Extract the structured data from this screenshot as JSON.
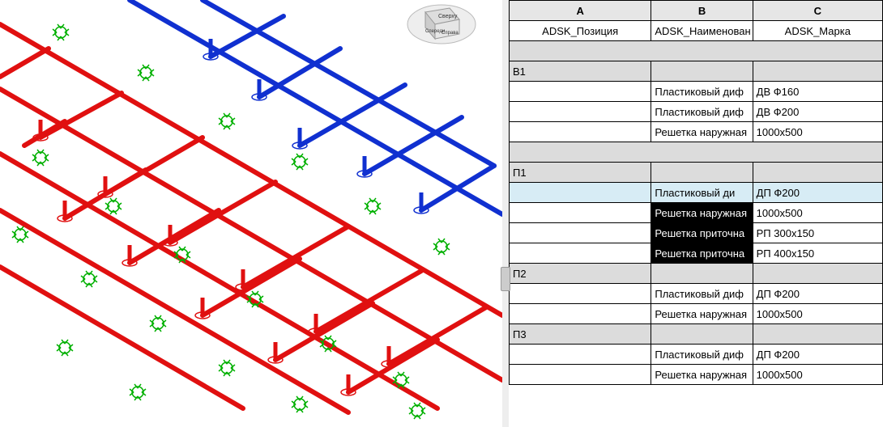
{
  "viewport": {
    "cube_label_top": "Сверху",
    "cube_label_front": "Спереди",
    "cube_label_right": "Справа"
  },
  "table": {
    "col_letters": {
      "A": "A",
      "B": "B",
      "C": "C"
    },
    "headers": {
      "A": "ADSK_Позиция",
      "B": "ADSK_Наименован",
      "C": "ADSK_Марка"
    },
    "rows": [
      {
        "type": "blank"
      },
      {
        "type": "group",
        "A": "В1",
        "B": "",
        "C": ""
      },
      {
        "type": "data",
        "A": "",
        "B": "Пластиковый диф",
        "C": "ДВ Ф160"
      },
      {
        "type": "data",
        "A": "",
        "B": "Пластиковый диф",
        "C": "ДВ Ф200"
      },
      {
        "type": "data",
        "A": "",
        "B": "Решетка наружная",
        "C": "1000х500"
      },
      {
        "type": "blank"
      },
      {
        "type": "group",
        "A": "П1",
        "B": "",
        "C": ""
      },
      {
        "type": "data",
        "A": "",
        "B": "Пластиковый ди",
        "C": "ДП Ф200",
        "selected": "active"
      },
      {
        "type": "data",
        "A": "",
        "B": "Решетка наружная",
        "C": "1000х500",
        "selected": "block"
      },
      {
        "type": "data",
        "A": "",
        "B": "Решетка приточна",
        "C": "РП 300х150",
        "selected": "block"
      },
      {
        "type": "data",
        "A": "",
        "B": "Решетка приточна",
        "C": "РП 400х150",
        "selected": "block"
      },
      {
        "type": "group",
        "A": "П2",
        "B": "",
        "C": ""
      },
      {
        "type": "data",
        "A": "",
        "B": "Пластиковый диф",
        "C": "ДП Ф200"
      },
      {
        "type": "data",
        "A": "",
        "B": "Решетка наружная",
        "C": "1000х500"
      },
      {
        "type": "group",
        "A": "П3",
        "B": "",
        "C": ""
      },
      {
        "type": "data",
        "A": "",
        "B": "Пластиковый диф",
        "C": "ДП Ф200"
      },
      {
        "type": "data",
        "A": "",
        "B": "Решетка наружная",
        "C": "1000х500"
      }
    ]
  }
}
